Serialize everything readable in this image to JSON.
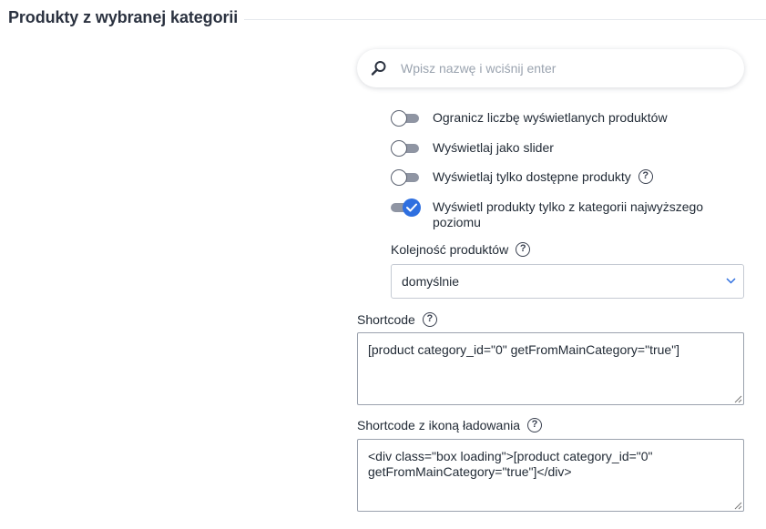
{
  "section": {
    "title": "Produkty z wybranej kategorii"
  },
  "search": {
    "placeholder": "Wpisz nazwę i wciśnij enter"
  },
  "options": [
    {
      "label": "Ogranicz liczbę wyświetlanych produktów",
      "enabled": false
    },
    {
      "label": "Wyświetlaj jako slider",
      "enabled": false
    },
    {
      "label": "Wyświetlaj tylko dostępne produkty",
      "enabled": false,
      "help": "?"
    },
    {
      "label": "Wyświetl produkty tylko z kategorii najwyższego poziomu",
      "enabled": true
    }
  ],
  "order": {
    "label": "Kolejność produktów",
    "help": "?",
    "selected": "domyślnie"
  },
  "shortcode": {
    "label": "Shortcode",
    "help": "?",
    "value": "[product category_id=\"0\" getFromMainCategory=\"true\"]"
  },
  "shortcode_loading": {
    "label": "Shortcode z ikoną ładowania",
    "help": "?",
    "value": "<div class=\"box loading\">[product category_id=\"0\" getFromMainCategory=\"true\"]</div>"
  },
  "colors": {
    "accent": "#2e6fe0",
    "toggle_track": "#8f95a3",
    "border": "#c5cad3"
  }
}
